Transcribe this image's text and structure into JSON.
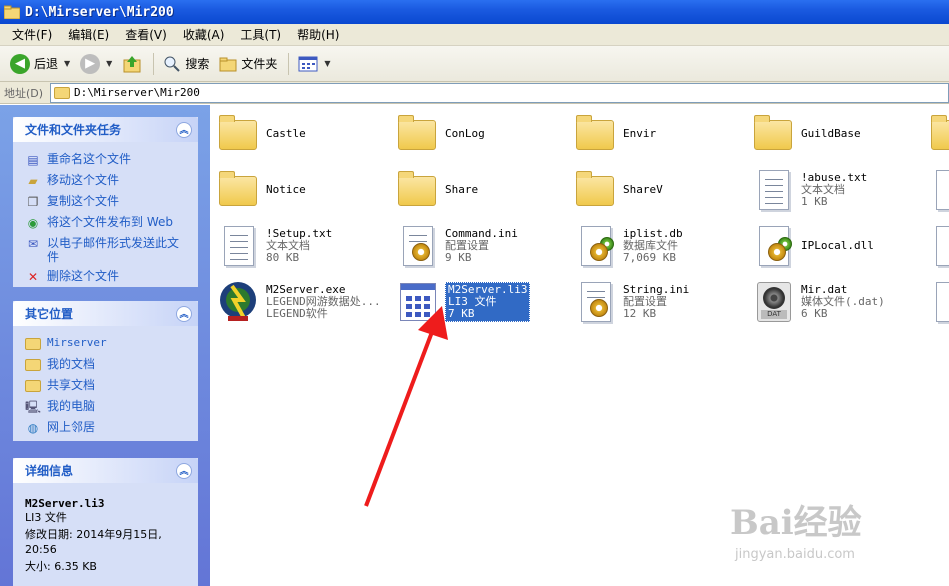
{
  "window": {
    "title": "D:\\Mirserver\\Mir200"
  },
  "menu": [
    "文件(F)",
    "编辑(E)",
    "查看(V)",
    "收藏(A)",
    "工具(T)",
    "帮助(H)"
  ],
  "toolbar": {
    "back_label": "后退",
    "search_label": "搜索",
    "folders_label": "文件夹"
  },
  "address": {
    "label": "地址(D)",
    "value": "D:\\Mirserver\\Mir200"
  },
  "tasks": {
    "title": "文件和文件夹任务",
    "items": [
      "重命名这个文件",
      "移动这个文件",
      "复制这个文件",
      "将这个文件发布到 Web",
      "以电子邮件形式发送此文件",
      "删除这个文件"
    ]
  },
  "places": {
    "title": "其它位置",
    "items": [
      "Mirserver",
      "我的文档",
      "共享文档",
      "我的电脑",
      "网上邻居"
    ]
  },
  "details": {
    "title": "详细信息",
    "name": "M2Server.li3",
    "type": "LI3 文件",
    "modified": "修改日期: 2014年9月15日, 20:56",
    "size": "大小: 6.35 KB"
  },
  "files": [
    {
      "name": "Castle"
    },
    {
      "name": "ConLog"
    },
    {
      "name": "Envir"
    },
    {
      "name": "GuildBase"
    },
    {
      "name": "Notice"
    },
    {
      "name": "Share"
    },
    {
      "name": "ShareV"
    },
    {
      "name": "!abuse.txt",
      "type": "文本文档",
      "size": "1 KB"
    },
    {
      "name": "!Setup.txt",
      "type": "文本文档",
      "size": "80 KB"
    },
    {
      "name": "Command.ini",
      "type": "配置设置",
      "size": "9 KB"
    },
    {
      "name": "iplist.db",
      "type": "数据库文件",
      "size": "7,069 KB"
    },
    {
      "name": "IPLocal.dll"
    },
    {
      "name": "M2Server.exe",
      "type": "LEGEND网游数据处...",
      "size": "LEGEND软件"
    },
    {
      "name": "M2Server.li3",
      "type": "LI3 文件",
      "size": "7 KB"
    },
    {
      "name": "String.ini",
      "type": "配置设置",
      "size": "12 KB"
    },
    {
      "name": "Mir.dat",
      "type": "媒体文件(.dat)",
      "size": "6 KB"
    }
  ],
  "film_tag": "DAT",
  "watermark": {
    "brand": "Bai经验",
    "url": "jingyan.baidu.com"
  }
}
